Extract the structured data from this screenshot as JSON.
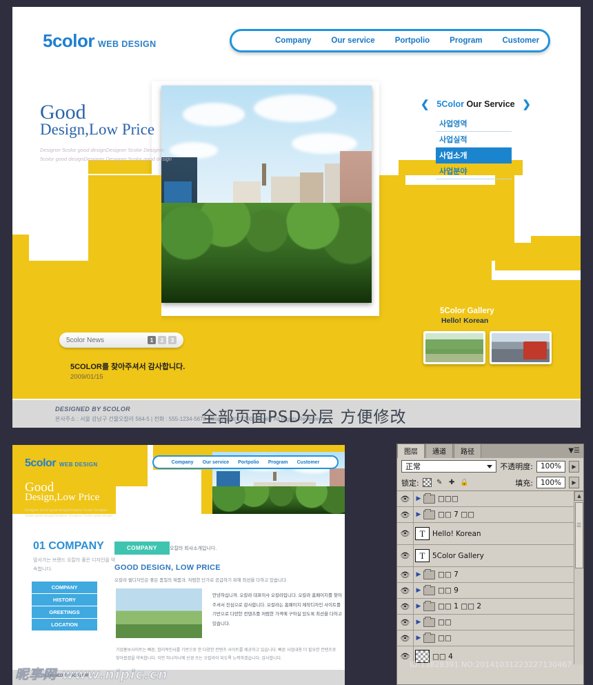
{
  "site": {
    "logo": {
      "main": "5color",
      "sub": "WEB DESIGN"
    },
    "nav": [
      {
        "label": "Company"
      },
      {
        "label": "Our service"
      },
      {
        "label": "Portpolio"
      },
      {
        "label": "Program"
      },
      {
        "label": "Customer"
      }
    ],
    "hero": {
      "headline_line1": "Good",
      "headline_line2": "Design,Low Price",
      "subtext_line1": "Designer 5color good designDesigner 5color Designer",
      "subtext_line2": "5color good designDesigner  Designer 5color good design"
    },
    "service_panel": {
      "prev_icon": "chevron-left-icon",
      "next_icon": "chevron-right-icon",
      "title_accent": "5Color",
      "title_rest": " Our Service",
      "items": [
        {
          "label": "사업영역",
          "selected": false
        },
        {
          "label": "사업실적",
          "selected": false
        },
        {
          "label": "사업소개",
          "selected": true
        },
        {
          "label": "사업분야",
          "selected": false
        }
      ]
    },
    "news": {
      "label": "5color News",
      "pages": [
        "1",
        "2",
        "3"
      ],
      "active_page": "1",
      "headline": "5COLOR를 찾아주셔서 감사합니다.",
      "date": "2009/01/15"
    },
    "gallery": {
      "title": "5Color Gallery",
      "subtitle": "Hello! Korean",
      "thumbs": [
        "garden-path-photo",
        "city-street-bus-photo"
      ]
    },
    "footer": {
      "designed_by": "DESIGNED BY 5COLOR",
      "address": "본사주소 : 서울 강남구 건물오칼라 564-5  |  전화 : 555-1234-5678  |  Copyright(C) 2009 5color All Rights Reserved."
    },
    "overlay_text": "全部页面PSD分层 方便修改"
  },
  "subpage": {
    "logo": {
      "main": "5color",
      "sub": "WEB DESIGN"
    },
    "nav": [
      {
        "label": "Company"
      },
      {
        "label": "Our service"
      },
      {
        "label": "Portpolio"
      },
      {
        "label": "Program"
      },
      {
        "label": "Customer"
      }
    ],
    "hero": {
      "headline_line1": "Good",
      "headline_line2": "Design,Low Price",
      "subtext_line1": "Designer 5color good designDesigner 5color Designer",
      "subtext_line2": "5color good designDesigner Designer 5color good design"
    },
    "section_title": "01 COMPANY",
    "section_desc": "앞서가는 브랜드 오칼라 좋은 디자인을 약속합니다.",
    "menu": [
      {
        "label": "COMPANY"
      },
      {
        "label": "HISTORY"
      },
      {
        "label": "GREETINGS"
      },
      {
        "label": "LOCATION"
      }
    ],
    "tab_label": "COMPANY",
    "tab_note": "오칼라 회사소개입니다.",
    "content_heading": "GOOD DESIGN, LOW PRICE",
    "content_sub": "오칼라 웹디자인은 좋은 품질의 제품과, 저렴한 단가로 공급하기 위해 최선을 다하고 있습니다.",
    "body_text": "안녕하십니까.\n오칼라 대표이사 오칼라입니다. 오칼라 홈페이지를 찾아주셔서 진심으로 감사합니다.\n오칼라는 홈페이지 제작디자인 사이트를 기반으로 다양한 컨텐츠를 저렴한 가격에 구하실 있도록 최선을 다하고 있습니다.",
    "body_text2": "기업홍보사이트는 빠른, 합리적인사를 기반으로 한 다양한 컨텐츠 사이트를 제공하고 있습니다. 빠른 사업내용 더 필요한 컨텐츠로 찾아봅겠을 약속합니다. 이만 하나하나에 신경 쓰는 오칼라이 되도록 노력하겠습니다. 감사합니다.",
    "footer_designed_by": "DESIGNED BY 5COLOR"
  },
  "watermarks": {
    "nipic": "昵享网 www.nipic.cn",
    "id_line": "ID:13828391 NO:20141031223227130467"
  },
  "photoshop": {
    "tabs": [
      {
        "label": "图层",
        "active": true
      },
      {
        "label": "通道",
        "active": false
      },
      {
        "label": "路径",
        "active": false
      }
    ],
    "panel_menu_icon": "panel-menu-icon",
    "blend_mode": "正常",
    "opacity_label": "不透明度:",
    "opacity_value": "100%",
    "lock_label": "锁定:",
    "lock_icons": [
      "transparency-lock-icon",
      "brush-lock-icon",
      "move-lock-icon",
      "all-lock-icon"
    ],
    "fill_label": "填充:",
    "fill_value": "100%",
    "layers": [
      {
        "type": "group",
        "name": "□□□",
        "visible": true
      },
      {
        "type": "group",
        "name": "□□ 7 □□",
        "visible": true
      },
      {
        "type": "text",
        "name": "Hello! Korean",
        "visible": true
      },
      {
        "type": "text",
        "name": "5Color Gallery",
        "visible": true
      },
      {
        "type": "group",
        "name": "□□ 7",
        "visible": true
      },
      {
        "type": "group",
        "name": "□□ 9",
        "visible": true
      },
      {
        "type": "group",
        "name": "□□ 1 □□ 2",
        "visible": true
      },
      {
        "type": "group",
        "name": "□□",
        "visible": true
      },
      {
        "type": "group",
        "name": "□□",
        "visible": true
      },
      {
        "type": "pixel",
        "name": "□□ 4",
        "visible": true
      }
    ]
  },
  "colors": {
    "yellow": "#efc517",
    "brand_blue": "#1f7fd0",
    "nav_blue": "#2293dc",
    "selected_blue": "#1b84cf",
    "ps_gray": "#d4d0c8"
  }
}
